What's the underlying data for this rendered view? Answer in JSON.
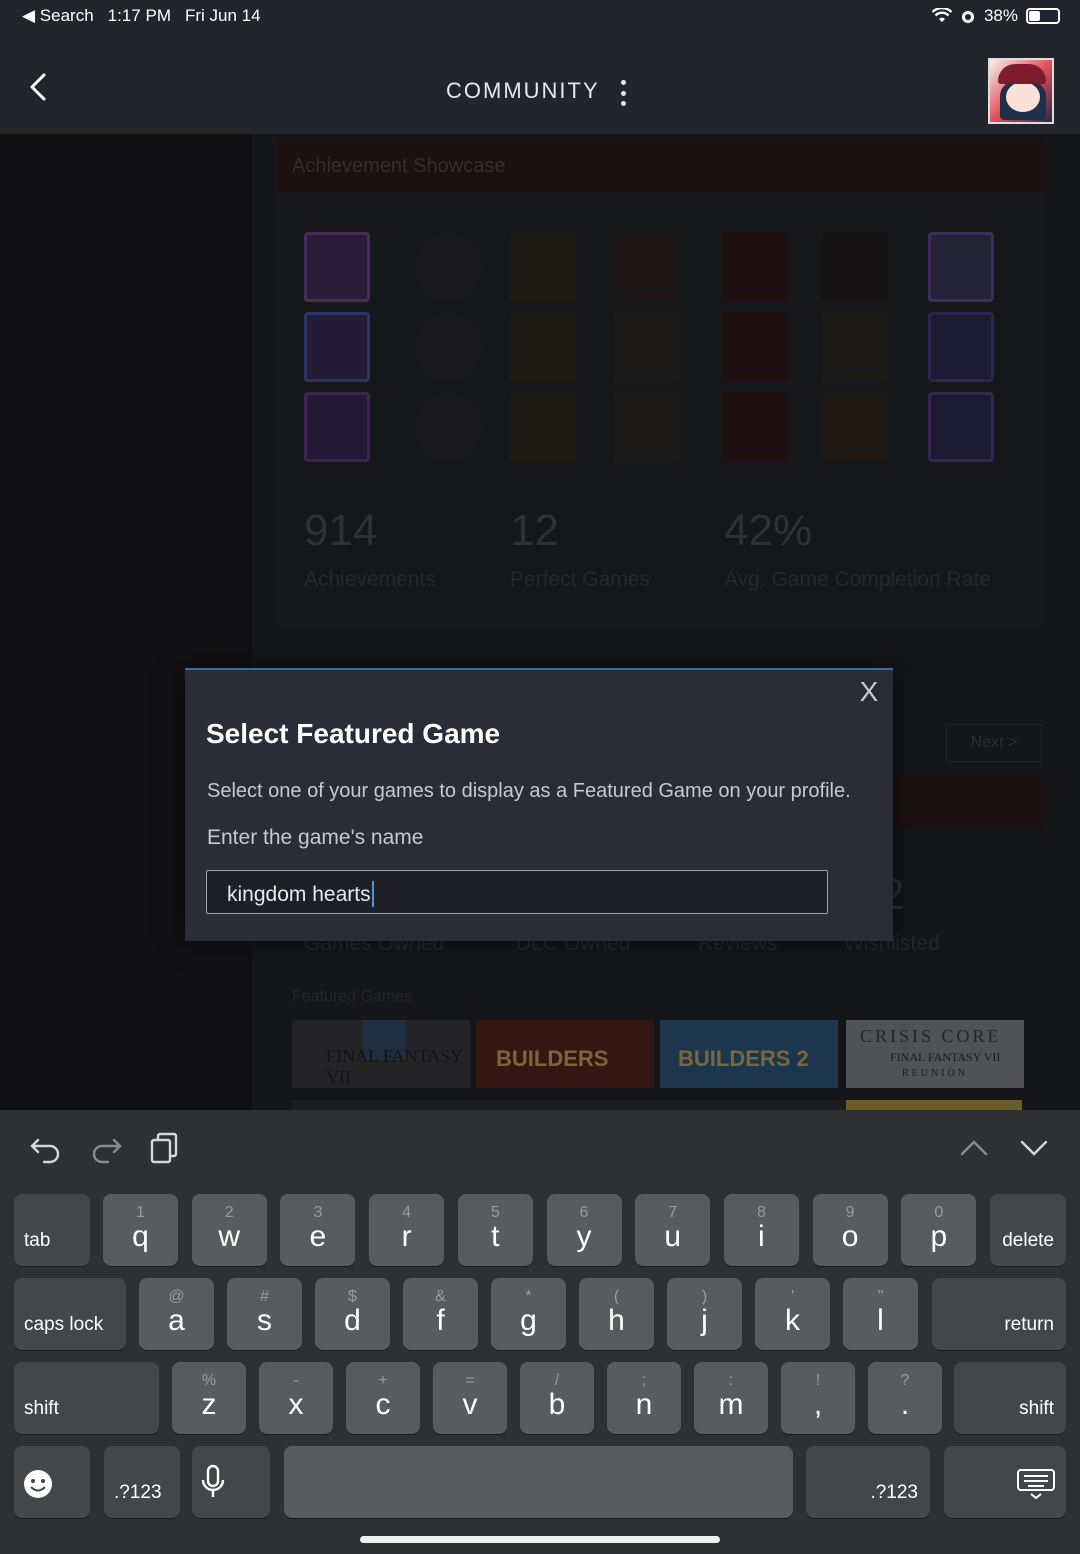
{
  "status_bar": {
    "back_app": "Search",
    "time": "1:17 PM",
    "date": "Fri Jun 14",
    "battery": "38%",
    "battery_level": 0.38
  },
  "nav": {
    "title": "COMMUNITY",
    "back_icon": "chevron-left-icon",
    "more_icon": "more-vertical-icon"
  },
  "background": {
    "achievement_showcase": "Achievement Showcase",
    "stats": [
      {
        "value": "914",
        "label": "Achievements"
      },
      {
        "value": "12",
        "label": "Perfect Games"
      },
      {
        "value": "42%",
        "label": "Avg. Game Completion Rate"
      }
    ],
    "next_button": "Next >",
    "game_stats_partial_value": "2",
    "game_stats": [
      "Games Owned",
      "DLC Owned",
      "Reviews",
      "Wishlisted"
    ],
    "featured_games_title": "Featured Games",
    "featured_games": [
      {
        "name": "FINAL FANTASY VII",
        "color": "#2a2a2e"
      },
      {
        "name": "BUILDERS",
        "color": "#6a1a16"
      },
      {
        "name": "BUILDERS 2",
        "color": "#1e6aa6"
      },
      {
        "name": "CRISIS CORE",
        "sub": "FINAL FANTASY VII",
        "sub2": "REUNION",
        "color": "#d9dde2"
      }
    ]
  },
  "modal": {
    "title": "Select Featured Game",
    "description": "Select one of your games to display as a Featured Game on your profile.",
    "input_label": "Enter the game's name",
    "input_value": "kingdom hearts",
    "close_glyph": "X"
  },
  "keyboard": {
    "row1": [
      {
        "main": "q",
        "sub": "1"
      },
      {
        "main": "w",
        "sub": "2"
      },
      {
        "main": "e",
        "sub": "3"
      },
      {
        "main": "r",
        "sub": "4"
      },
      {
        "main": "t",
        "sub": "5"
      },
      {
        "main": "y",
        "sub": "6"
      },
      {
        "main": "u",
        "sub": "7"
      },
      {
        "main": "i",
        "sub": "8"
      },
      {
        "main": "o",
        "sub": "9"
      },
      {
        "main": "p",
        "sub": "0"
      }
    ],
    "row2": [
      {
        "main": "a",
        "sub": "@"
      },
      {
        "main": "s",
        "sub": "#"
      },
      {
        "main": "d",
        "sub": "$"
      },
      {
        "main": "f",
        "sub": "&"
      },
      {
        "main": "g",
        "sub": "*"
      },
      {
        "main": "h",
        "sub": "("
      },
      {
        "main": "j",
        "sub": ")"
      },
      {
        "main": "k",
        "sub": "'"
      },
      {
        "main": "l",
        "sub": "\""
      }
    ],
    "row3": [
      {
        "main": "z",
        "sub": "%"
      },
      {
        "main": "x",
        "sub": "-"
      },
      {
        "main": "c",
        "sub": "+"
      },
      {
        "main": "v",
        "sub": "="
      },
      {
        "main": "b",
        "sub": "/"
      },
      {
        "main": "n",
        "sub": ";"
      },
      {
        "main": "m",
        "sub": ":"
      },
      {
        "main": ",",
        "sub": "!"
      },
      {
        "main": ".",
        "sub": "?"
      }
    ],
    "tab": "tab",
    "delete": "delete",
    "caps_lock": "caps lock",
    "return": "return",
    "shift": "shift",
    "numbers": ".?123"
  }
}
